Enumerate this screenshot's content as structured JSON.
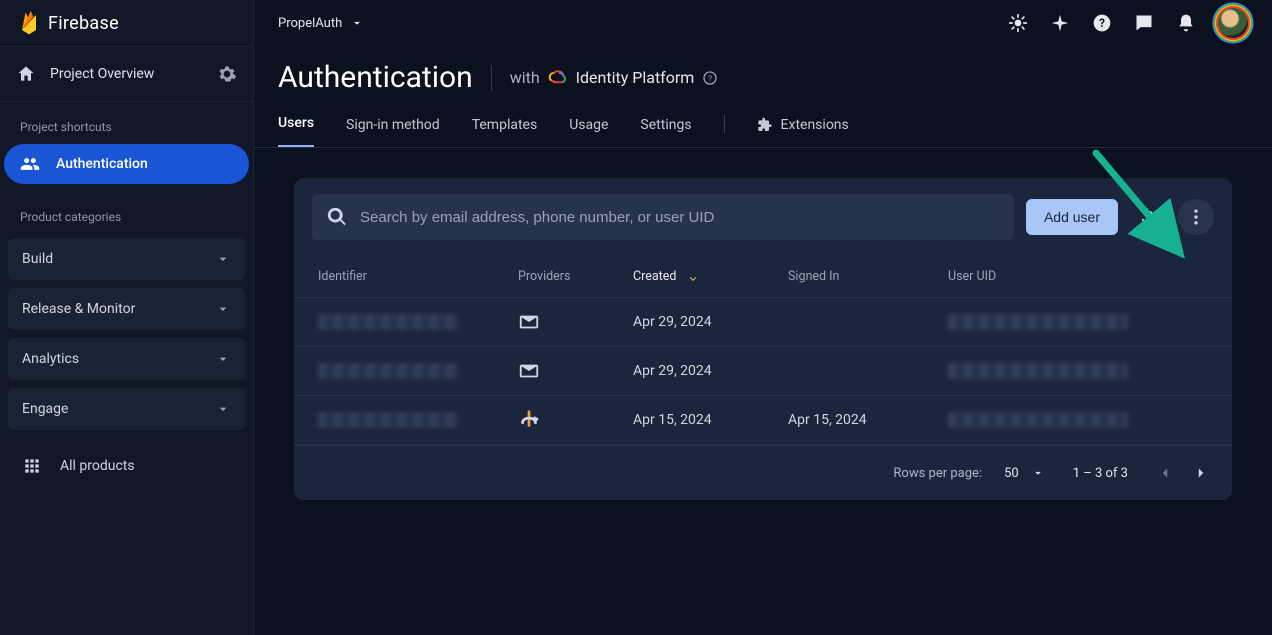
{
  "brand": "Firebase",
  "overview_label": "Project Overview",
  "shortcuts_label": "Project shortcuts",
  "active_nav_label": "Authentication",
  "categories_label": "Product categories",
  "categories": [
    "Build",
    "Release & Monitor",
    "Analytics",
    "Engage"
  ],
  "all_products_label": "All products",
  "project_name": "PropelAuth",
  "page_title": "Authentication",
  "with_label": "with",
  "identity_platform_label": "Identity Platform",
  "tabs": [
    "Users",
    "Sign-in method",
    "Templates",
    "Usage",
    "Settings"
  ],
  "extensions_label": "Extensions",
  "search_placeholder": "Search by email address, phone number, or user UID",
  "add_user_label": "Add user",
  "columns": {
    "identifier": "Identifier",
    "providers": "Providers",
    "created": "Created",
    "signed_in": "Signed In",
    "uid": "User UID"
  },
  "rows": [
    {
      "created": "Apr 29, 2024",
      "signed_in": "",
      "provider": "email"
    },
    {
      "created": "Apr 29, 2024",
      "signed_in": "",
      "provider": "email"
    },
    {
      "created": "Apr 15, 2024",
      "signed_in": "Apr 15, 2024",
      "provider": "oidc"
    }
  ],
  "pagination": {
    "rpp_label": "Rows per page:",
    "rpp_value": "50",
    "range": "1 – 3 of 3"
  }
}
